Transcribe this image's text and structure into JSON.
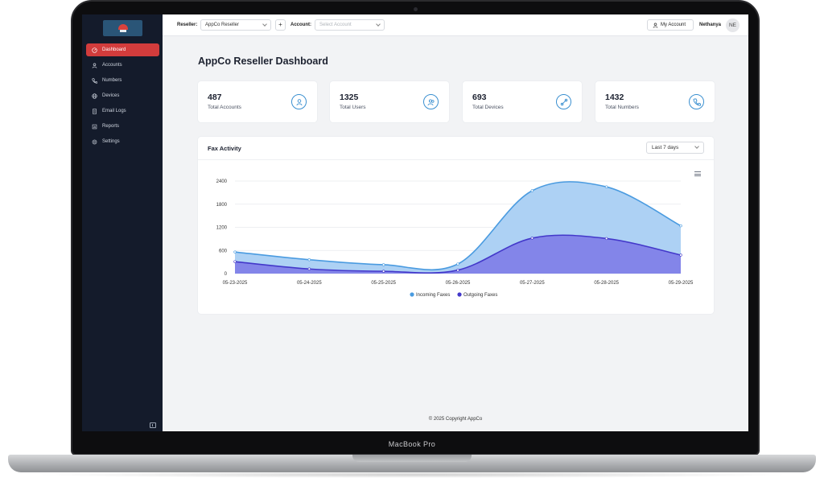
{
  "device": {
    "label": "MacBook Pro"
  },
  "sidebar": {
    "items": [
      {
        "label": "Dashboard",
        "icon": "dashboard-icon",
        "active": true
      },
      {
        "label": "Accounts",
        "icon": "user-icon",
        "active": false
      },
      {
        "label": "Numbers",
        "icon": "phone-icon",
        "active": false
      },
      {
        "label": "Devices",
        "icon": "globe-icon",
        "active": false
      },
      {
        "label": "Email Logs",
        "icon": "document-icon",
        "active": false
      },
      {
        "label": "Reports",
        "icon": "report-icon",
        "active": false
      },
      {
        "label": "Settings",
        "icon": "gear-icon",
        "active": false
      }
    ]
  },
  "topbar": {
    "reseller_label": "Reseller:",
    "reseller_value": "AppCo Reseller",
    "add_label": "+",
    "account_label": "Account:",
    "account_placeholder": "Select Account",
    "my_account_label": "My Account",
    "user_name": "Nethanya",
    "avatar_initials": "NE"
  },
  "page": {
    "title": "AppCo Reseller Dashboard"
  },
  "stats": [
    {
      "value": "487",
      "label": "Total Accounts",
      "icon": "user-circle-icon"
    },
    {
      "value": "1325",
      "label": "Total Users",
      "icon": "users-icon"
    },
    {
      "value": "693",
      "label": "Total Devices",
      "icon": "device-link-icon"
    },
    {
      "value": "1432",
      "label": "Total Numbers",
      "icon": "phone-icon"
    }
  ],
  "chart_card": {
    "title": "Fax Activity",
    "range": "Last 7 days"
  },
  "chart_data": {
    "type": "area",
    "title": "Fax Activity",
    "x": [
      "05-23-2025",
      "05-24-2025",
      "05-25-2025",
      "05-26-2025",
      "05-27-2025",
      "05-28-2025",
      "05-29-2025"
    ],
    "y_ticks": [
      "0",
      "600",
      "1200",
      "1800",
      "2400"
    ],
    "ylim": [
      0,
      2400
    ],
    "series": [
      {
        "name": "Incoming Faxes",
        "color": "#4a9be0",
        "values": [
          560,
          360,
          230,
          250,
          2150,
          2250,
          1240
        ]
      },
      {
        "name": "Outgoing Faxes",
        "color": "#4338ca",
        "values": [
          310,
          120,
          60,
          90,
          920,
          910,
          480
        ]
      }
    ],
    "legend_position": "bottom",
    "grid": true
  },
  "footer": {
    "text": "© 2025 Copyright AppCo"
  }
}
